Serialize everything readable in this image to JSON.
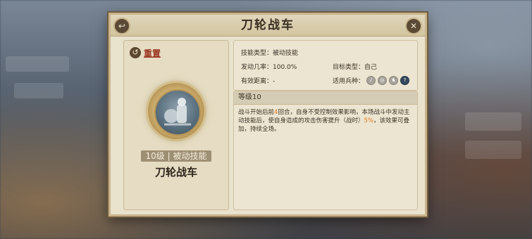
{
  "panel": {
    "title": "刀轮战车"
  },
  "left": {
    "reset_label": "重置",
    "level_badge": "10级 | 被动技能",
    "skill_name": "刀轮战车"
  },
  "info": {
    "skill_type": "技能类型：被动技能",
    "trigger_rate": "发动几率：100.0%",
    "target_type": "目标类型：自己",
    "range": "有效距离：-",
    "unit_types_label": "适用兵种："
  },
  "unit_icons": [
    {
      "name": "spear",
      "active": false
    },
    {
      "name": "shield",
      "active": false
    },
    {
      "name": "horse",
      "active": false
    },
    {
      "name": "unknown",
      "active": true
    }
  ],
  "desc": {
    "level_header": "等级10",
    "part1": "战斗开始后前",
    "turns": "4",
    "part2": "回合，自身不受控制效果影响，本场战斗中发动主动技能后，使自身造成的攻击伤害提升（战时）",
    "percent": "5%",
    "part3": "，该效果可叠加，持续全场。"
  },
  "colors": {
    "highlight": "#e57a1c",
    "panel_bg": "#e9e2cd",
    "frame": "#c9b48d"
  }
}
